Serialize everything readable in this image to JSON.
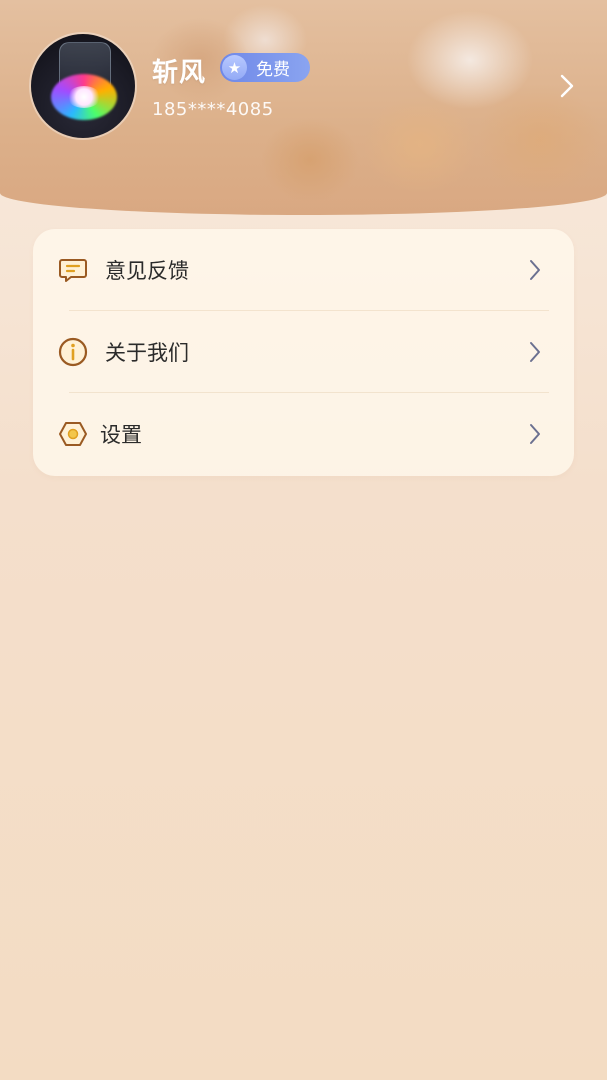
{
  "profile": {
    "username": "斩风",
    "badge_label": "免费",
    "phone": "185****4085"
  },
  "menu": {
    "items": [
      {
        "label": "意见反馈",
        "icon": "feedback-icon"
      },
      {
        "label": "关于我们",
        "icon": "info-icon"
      },
      {
        "label": "设置",
        "icon": "settings-icon"
      }
    ]
  },
  "colors": {
    "badge": "#7b94ec",
    "icon_accent": "#9a5a22",
    "chevron": "#6b7090",
    "card_bg": "#fff8ec"
  }
}
